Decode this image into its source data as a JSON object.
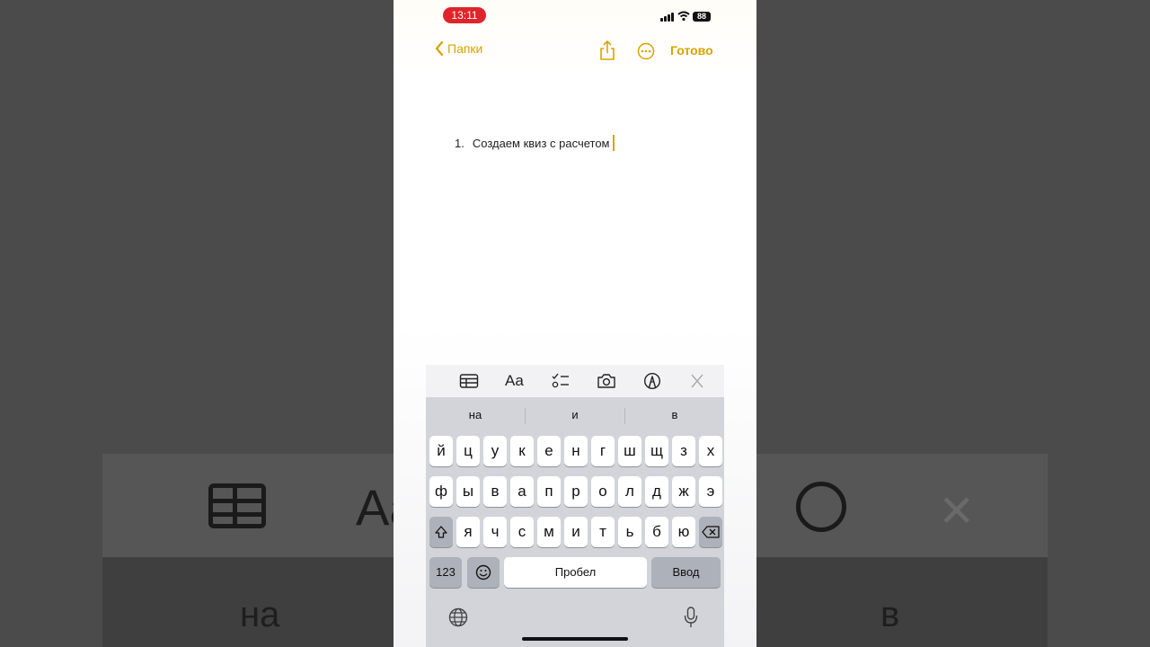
{
  "status_bar": {
    "time": "13:11",
    "battery": "88"
  },
  "nav": {
    "back_label": "Папки",
    "done_label": "Готово"
  },
  "note": {
    "number": "1.",
    "text": "Создаем квиз с расчетом"
  },
  "toolbar": {
    "format_label": "Aa"
  },
  "suggestions": [
    "на",
    "и",
    "в"
  ],
  "keyboard": {
    "row1": [
      "й",
      "ц",
      "у",
      "к",
      "е",
      "н",
      "г",
      "ш",
      "щ",
      "з",
      "х"
    ],
    "row2": [
      "ф",
      "ы",
      "в",
      "а",
      "п",
      "р",
      "о",
      "л",
      "д",
      "ж",
      "э"
    ],
    "row3": [
      "я",
      "ч",
      "с",
      "м",
      "и",
      "т",
      "ь",
      "б",
      "ю"
    ],
    "numbers_label": "123",
    "space_label": "Пробел",
    "return_label": "Ввод"
  },
  "background": {
    "format_label": "Aa",
    "suggestion_left": "на",
    "suggestion_right": "в"
  },
  "colors": {
    "accent": "#d9a300",
    "time_pill": "#e0242b",
    "keyboard_bg": "#d2d4da"
  }
}
